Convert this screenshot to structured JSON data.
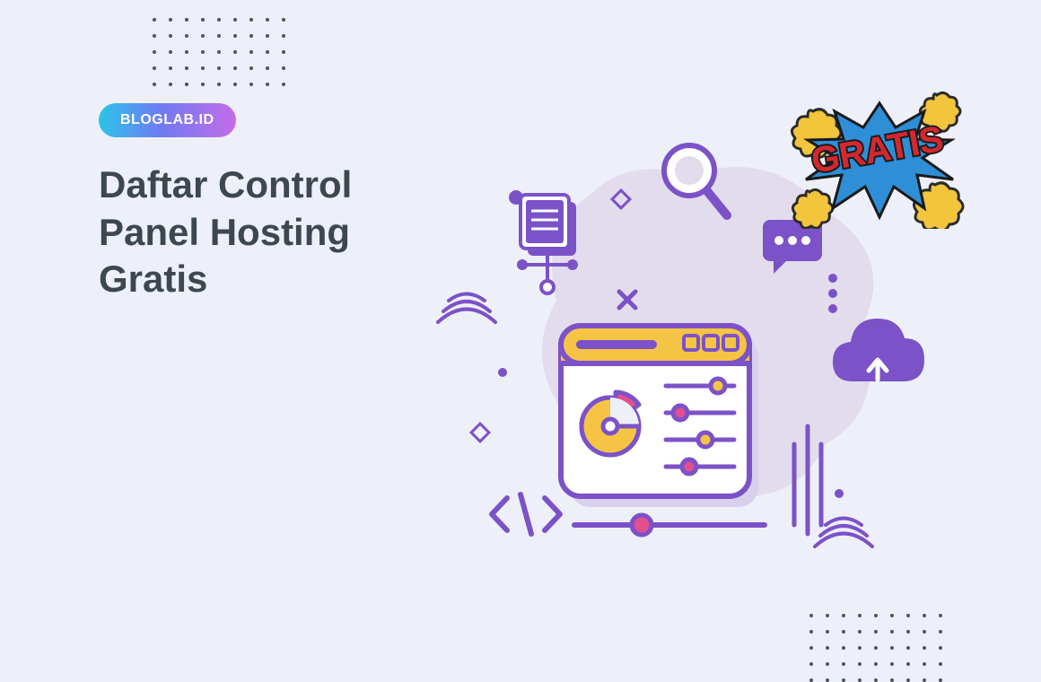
{
  "badge": {
    "label": "BLOGLAB.ID"
  },
  "headline": {
    "text": "Daftar Control Panel Hosting Gratis"
  },
  "sticker": {
    "text": "GRATIS"
  },
  "colors": {
    "bg": "#eef0f9",
    "text_dark": "#3d4752",
    "purple": "#7b52c7",
    "purple_light": "#d9d0ee",
    "yellow": "#f5c445",
    "magenta": "#e24f8f",
    "red": "#d3282f",
    "blue_spike": "#2e8ed6"
  }
}
